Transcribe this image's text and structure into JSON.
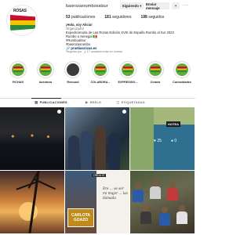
{
  "profile": {
    "avatar_text": "ROSAS",
    "username": "basrozasrumbosalsur",
    "buttons": {
      "follow": "Siguiendo ▾",
      "message": "Enviar mensaje"
    },
    "stats": [
      {
        "value": "53",
        "label": "publicaciones"
      },
      {
        "value": "181",
        "label": "seguidores"
      },
      {
        "value": "198",
        "label": "seguidos"
      }
    ],
    "bio": {
      "name": "¡Hola, soy Alicia!",
      "category": "Organizador",
      "lines": [
        "Expedicionaria de Las Rozas Edición XVIII de España Rumbo al Sur 2023",
        "Rumbo a Senegal 🇸🇳",
        "#RumboalSur",
        "#basrozasrumbo"
      ],
      "link": "🔗 pruebasrozas.es"
    },
    "followed_by": "Seguido por _y 17 usuarios más en común"
  },
  "highlights": [
    {
      "label": "FICHAS"
    },
    {
      "label": "Aventura"
    },
    {
      "label": "Remund"
    },
    {
      "label": "COLABORA..."
    },
    {
      "label": "EXPRESSIO..."
    },
    {
      "label": "Cintela"
    },
    {
      "label": "Curiosidades"
    }
  ],
  "tabs": [
    {
      "label": "PUBLICACIONES",
      "icon": "grid-icon",
      "active": true
    },
    {
      "label": "REELS",
      "icon": "reels-icon",
      "active": false
    },
    {
      "label": "ETIQUETADAS",
      "icon": "tag-icon",
      "active": false
    }
  ],
  "posts": {
    "map_label": "HOTEA",
    "map_stat_1": "♥ 25",
    "map_stat_2": "● 0",
    "c5_tag": "ORDA IX",
    "c5_plate_1": "CARLOTA",
    "c5_plate_2": "GOAZO",
    "c5_text": "Ere ... se ser mi mujer ... las llamada"
  },
  "colors": {
    "text": "#262626",
    "muted": "#737373",
    "link": "#00376b",
    "button_bg": "#efefef",
    "border": "#dbdbdb"
  }
}
